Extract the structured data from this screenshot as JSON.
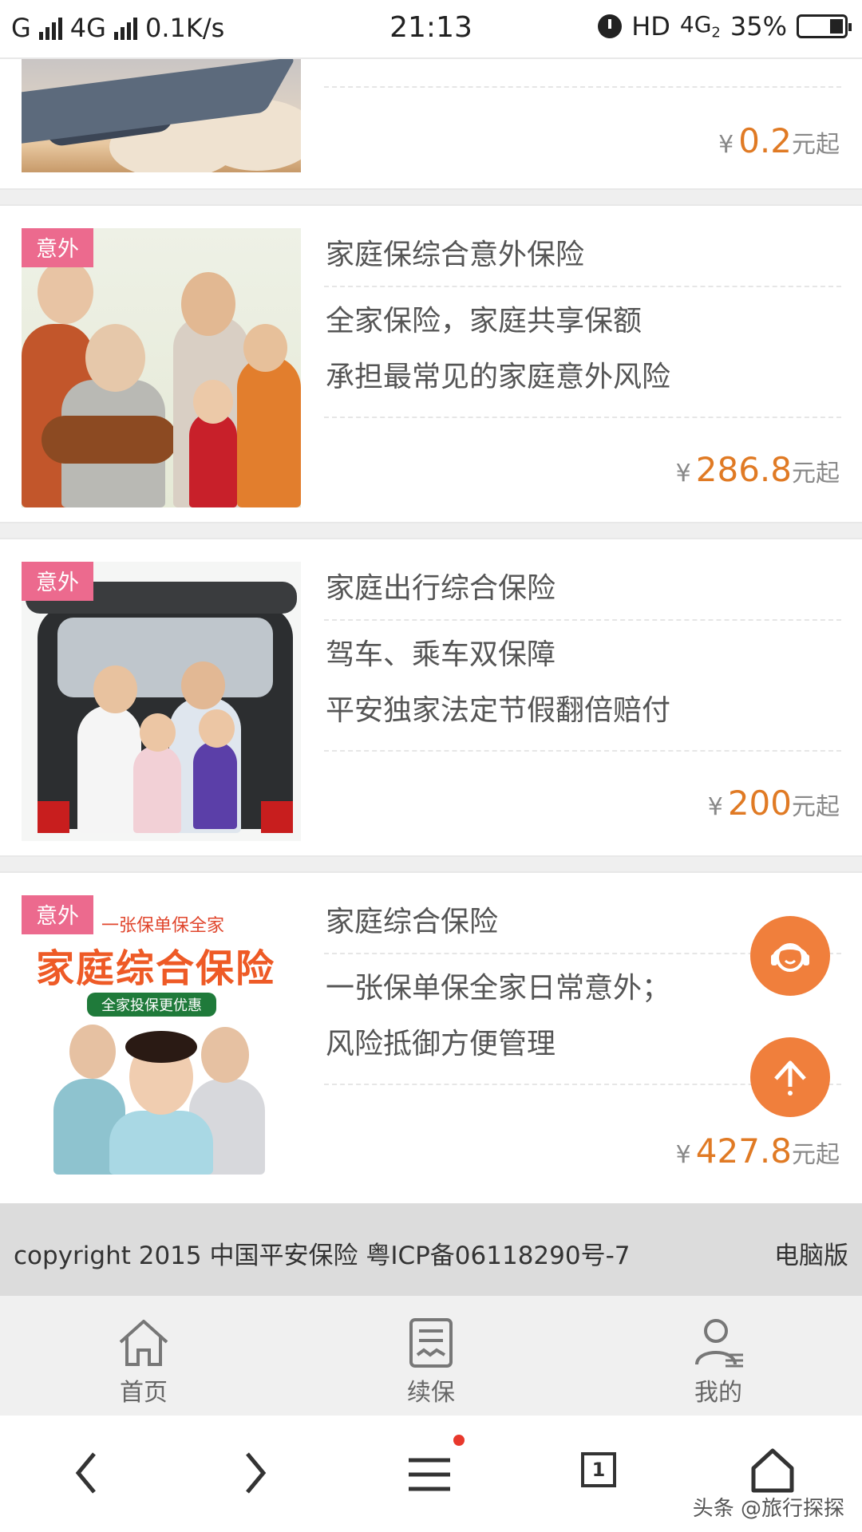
{
  "status_bar": {
    "carrier_left": "G",
    "network": "4G",
    "speed": "0.1K/s",
    "time": "21:13",
    "hd": "HD",
    "network_right": "4G",
    "network_right_sub": "2",
    "battery": "35%"
  },
  "products": [
    {
      "title": "",
      "lines": [],
      "price_prefix": "¥",
      "price": "0.2",
      "price_suffix": "元起"
    },
    {
      "tag": "意外",
      "title": "家庭保综合意外保险",
      "lines": [
        "全家保险，家庭共享保额",
        "承担最常见的家庭意外风险"
      ],
      "price_prefix": "¥",
      "price": "286.8",
      "price_suffix": "元起"
    },
    {
      "tag": "意外",
      "title": "家庭出行综合保险",
      "lines": [
        "驾车、乘车双保障",
        "平安独家法定节假翻倍赔付"
      ],
      "price_prefix": "¥",
      "price": "200",
      "price_suffix": "元起"
    },
    {
      "tag": "意外",
      "title": "家庭综合保险",
      "lines": [
        "一张保单保全家日常意外；",
        "风险抵御方便管理"
      ],
      "price_prefix": "¥",
      "price": "427.8",
      "price_suffix": "元起",
      "image_text": {
        "top": "一张保单保全家",
        "headline": "家庭综合保险",
        "banner": "全家投保更优惠"
      }
    }
  ],
  "footer": {
    "copyright": "copyright 2015 中国平安保险 粤ICP备06118290号-7",
    "pc_version": "电脑版"
  },
  "tabs": [
    {
      "label": "首页",
      "icon": "home-icon"
    },
    {
      "label": "续保",
      "icon": "renew-document-icon"
    },
    {
      "label": "我的",
      "icon": "user-icon"
    }
  ],
  "browser": {
    "tab_count": "1",
    "watermark": "头条 @旅行探探"
  },
  "colors": {
    "accent_price": "#e07a24",
    "tag_pink": "#ec6a8e",
    "fab_orange": "#f07f3c"
  }
}
